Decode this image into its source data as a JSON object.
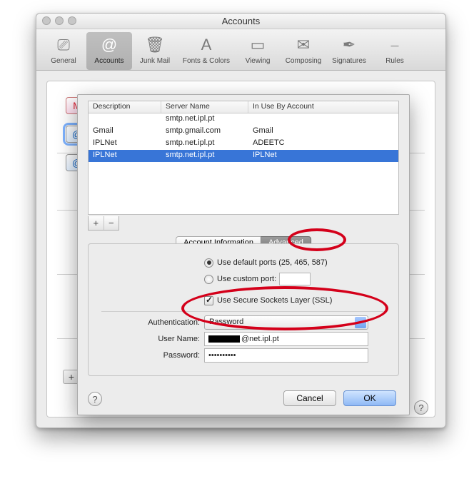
{
  "window": {
    "title": "Accounts"
  },
  "toolbar": {
    "items": [
      {
        "label": "General",
        "glyph": "⎚"
      },
      {
        "label": "Accounts",
        "glyph": "@"
      },
      {
        "label": "Junk Mail",
        "glyph": "🗑"
      },
      {
        "label": "Fonts & Colors",
        "glyph": "A"
      },
      {
        "label": "Viewing",
        "glyph": "▭"
      },
      {
        "label": "Composing",
        "glyph": "✉"
      },
      {
        "label": "Signatures",
        "glyph": "✒"
      },
      {
        "label": "Rules",
        "glyph": "⎯"
      }
    ]
  },
  "side_accounts": [
    "M",
    "@",
    "@"
  ],
  "smtp_table": {
    "headers": {
      "desc": "Description",
      "server": "Server Name",
      "inuse": "In Use By Account"
    },
    "rows": [
      {
        "desc": "",
        "server": "smtp.net.ipl.pt",
        "inuse": ""
      },
      {
        "desc": "Gmail",
        "server": "smtp.gmail.com",
        "inuse": "Gmail"
      },
      {
        "desc": "IPLNet",
        "server": "smtp.net.ipl.pt",
        "inuse": "ADEETC"
      },
      {
        "desc": "IPLNet",
        "server": "smtp.net.ipl.pt",
        "inuse": "IPLNet"
      }
    ],
    "add": "+",
    "remove": "−"
  },
  "tabs": {
    "info": "Account Information",
    "advanced": "Advanced"
  },
  "advanced": {
    "default_ports": "Use default ports (25, 465, 587)",
    "custom_port": "Use custom port:",
    "ssl": "Use Secure Sockets Layer (SSL)",
    "auth_label": "Authentication:",
    "auth_value": "Password",
    "user_label": "User Name:",
    "user_value": "@net.ipl.pt",
    "pass_label": "Password:",
    "pass_value": "••••••••••"
  },
  "buttons": {
    "cancel": "Cancel",
    "ok": "OK"
  },
  "help": "?",
  "plus_bg": "+"
}
